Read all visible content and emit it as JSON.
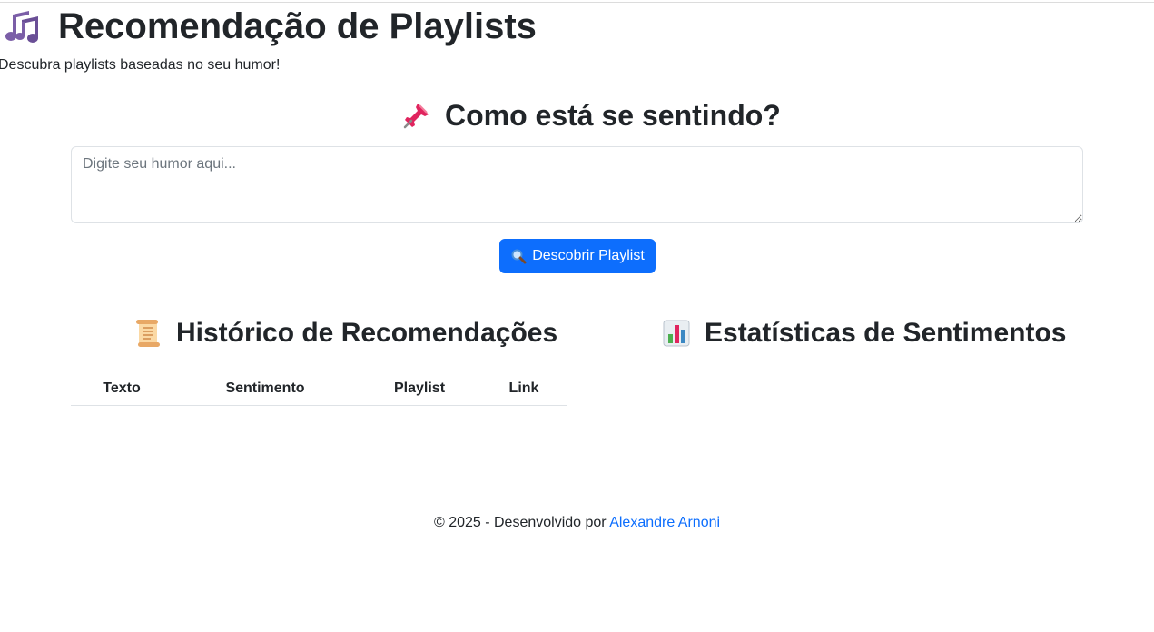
{
  "header": {
    "icon": "music-notes-icon",
    "title": "Recomendação de Playlists",
    "subtitle": "Descubra playlists baseadas no seu humor!"
  },
  "mood": {
    "icon": "pushpin-icon",
    "heading": "Como está se sentindo?",
    "placeholder": "Digite seu humor aqui...",
    "value": ""
  },
  "discover_button": {
    "icon": "magnifier-icon",
    "label": "Descobrir Playlist",
    "color": "#0d6efd"
  },
  "history": {
    "icon": "scroll-icon",
    "heading": "Histórico de Recomendações",
    "columns": [
      "Texto",
      "Sentimento",
      "Playlist",
      "Link"
    ],
    "rows": []
  },
  "stats": {
    "icon": "bar-chart-icon",
    "heading": "Estatísticas de Sentimentos"
  },
  "footer": {
    "text": "© 2025 - Desenvolvido por",
    "author_link": "Alexandre Arnoni"
  }
}
